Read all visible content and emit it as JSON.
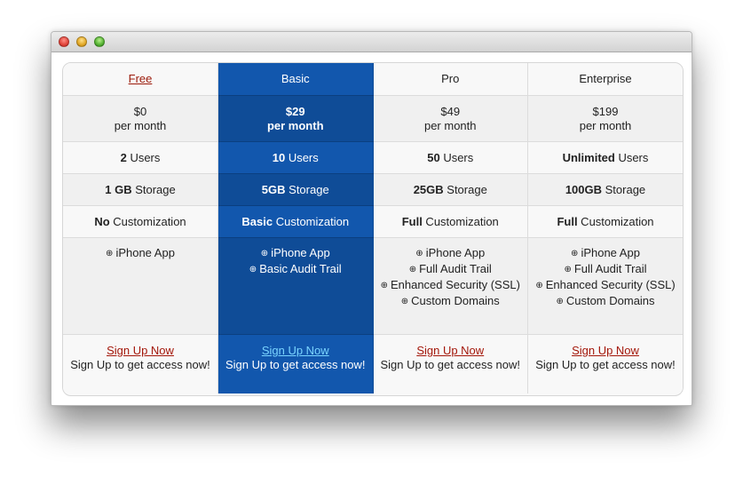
{
  "plans": [
    {
      "name": "Free",
      "name_is_link": true,
      "price": "$0",
      "period": "per month",
      "users_bold": "2",
      "users_text": " Users",
      "storage_bold": "1 GB",
      "storage_text": " Storage",
      "custom_bold": "No",
      "custom_text": " Customization",
      "features": [
        "iPhone App"
      ],
      "signup_label": "Sign Up Now",
      "signup_desc": "Sign Up to get access now!"
    },
    {
      "name": "Basic",
      "name_is_link": false,
      "price": "$29",
      "period": "per month",
      "users_bold": "10",
      "users_text": " Users",
      "storage_bold": "5GB",
      "storage_text": " Storage",
      "custom_bold": "Basic",
      "custom_text": " Customization",
      "features": [
        "iPhone App",
        "Basic Audit Trail"
      ],
      "signup_label": "Sign Up Now",
      "signup_desc": "Sign Up to get access now!"
    },
    {
      "name": "Pro",
      "name_is_link": false,
      "price": "$49",
      "period": "per month",
      "users_bold": "50",
      "users_text": " Users",
      "storage_bold": "25GB",
      "storage_text": " Storage",
      "custom_bold": "Full",
      "custom_text": " Customization",
      "features": [
        "iPhone App",
        "Full Audit Trail",
        "Enhanced Security (SSL)",
        "Custom Domains"
      ],
      "signup_label": "Sign Up Now",
      "signup_desc": "Sign Up to get access now!"
    },
    {
      "name": "Enterprise",
      "name_is_link": false,
      "price": "$199",
      "period": "per month",
      "users_bold": "Unlimited",
      "users_text": " Users",
      "storage_bold": "100GB",
      "storage_text": " Storage",
      "custom_bold": "Full",
      "custom_text": " Customization",
      "features": [
        "iPhone App",
        "Full Audit Trail",
        "Enhanced Security (SSL)",
        "Custom Domains"
      ],
      "signup_label": "Sign Up Now",
      "signup_desc": "Sign Up to get access now!"
    }
  ],
  "highlighted_plan": "Basic",
  "feature_bullet_icon": "circled-plus-icon",
  "colors": {
    "highlight": "#1257ad",
    "highlight_dark": "#0f4c97",
    "link": "#9b1a0a",
    "highlight_link": "#7ad4ff"
  }
}
